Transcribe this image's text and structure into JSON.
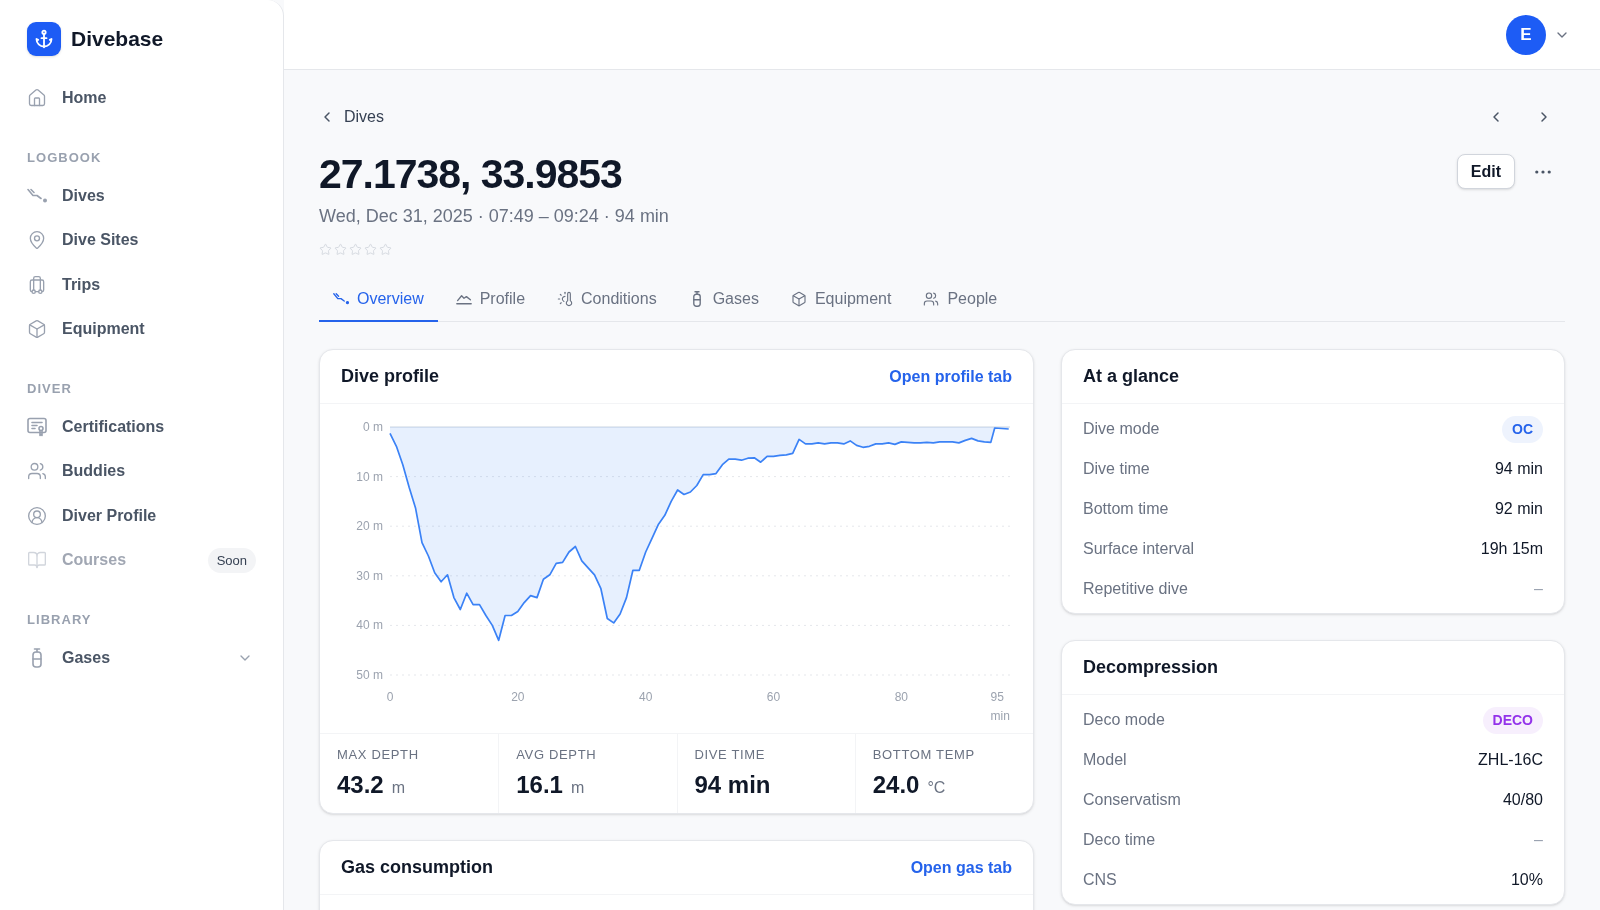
{
  "sidebar": {
    "brand": "Divebase",
    "sections": [
      {
        "items": [
          {
            "label": "Home",
            "disabled": false
          }
        ]
      },
      {
        "title": "LOGBOOK",
        "items": [
          {
            "label": "Dives",
            "disabled": false
          },
          {
            "label": "Dive Sites",
            "disabled": false
          },
          {
            "label": "Trips",
            "disabled": false
          },
          {
            "label": "Equipment",
            "disabled": false
          }
        ]
      },
      {
        "title": "DIVER",
        "items": [
          {
            "label": "Certifications",
            "disabled": false
          },
          {
            "label": "Buddies",
            "disabled": false
          },
          {
            "label": "Diver Profile",
            "disabled": false
          },
          {
            "label": "Courses",
            "disabled": true,
            "badge": "Soon"
          }
        ]
      },
      {
        "title": "LIBRARY",
        "items": [
          {
            "label": "Gases",
            "disabled": false,
            "expanded": false
          }
        ]
      }
    ]
  },
  "topbar": {
    "avatar_initial": "E"
  },
  "header": {
    "back_link": "Dives",
    "title": "27.1738, 33.9853",
    "subtitle": "Wed, Dec 31, 2025 · 07:49 – 09:24 · 94 min",
    "stars": 0,
    "edit_button": "Edit"
  },
  "tabs": [
    {
      "label": "Overview",
      "selected": true
    },
    {
      "label": "Profile",
      "selected": false
    },
    {
      "label": "Conditions",
      "selected": false
    },
    {
      "label": "Gases",
      "selected": false
    },
    {
      "label": "Equipment",
      "selected": false
    },
    {
      "label": "People",
      "selected": false
    }
  ],
  "dive_profile": {
    "title": "Dive profile",
    "link": "Open profile tab",
    "chart_data": {
      "type": "area",
      "grid": true,
      "xlabel": "min",
      "xlim": [
        0,
        97
      ],
      "ylim": [
        50,
        0
      ],
      "xticks": [
        0,
        20,
        40,
        60,
        80,
        95
      ],
      "yticks": [
        {
          "value": 0,
          "label": "0 m"
        },
        {
          "value": 10,
          "label": "10 m"
        },
        {
          "value": 20,
          "label": "20 m"
        },
        {
          "value": 30,
          "label": "30 m"
        },
        {
          "value": 40,
          "label": "40 m"
        },
        {
          "value": 50,
          "label": "50 m"
        }
      ],
      "x": [
        0,
        1,
        2,
        3,
        4,
        5,
        6,
        7,
        8,
        9,
        10,
        11,
        12,
        13,
        14,
        15,
        16,
        17,
        18,
        19,
        20,
        21,
        22,
        23,
        24,
        25,
        26,
        27,
        28,
        29,
        30,
        31,
        32,
        33,
        34,
        35,
        36,
        37,
        38,
        39,
        40,
        41,
        42,
        43,
        44,
        45,
        46,
        47,
        48,
        49,
        50,
        51,
        52,
        53,
        54,
        55,
        56,
        57,
        58,
        59,
        60,
        61,
        62,
        63,
        64,
        65,
        66,
        67,
        68,
        69,
        70,
        71,
        72,
        73,
        74,
        75,
        76,
        77,
        78,
        79,
        80,
        81,
        82,
        83,
        84,
        85,
        86,
        87,
        88,
        89,
        90,
        91,
        92,
        93,
        94,
        94.6,
        96.8
      ],
      "series": [
        {
          "color": "#3b82f6",
          "values": [
            1.3,
            3.9,
            7.6,
            12.2,
            16.4,
            23.3,
            26,
            29.4,
            31.2,
            29.8,
            34.4,
            36.8,
            33.5,
            35.8,
            35.8,
            38,
            40,
            43,
            38,
            38,
            37.2,
            35.4,
            34,
            34.4,
            30.7,
            29.8,
            27.5,
            27.3,
            25.2,
            24.1,
            27,
            28.4,
            29.8,
            32.6,
            38.6,
            39.5,
            37.7,
            34.4,
            28.9,
            28.9,
            25.2,
            22.4,
            19.6,
            17.8,
            15,
            12.7,
            13.6,
            13.1,
            11.8,
            9.6,
            9.6,
            9.4,
            7.6,
            6.5,
            6.5,
            6.7,
            6.3,
            6.2,
            7.1,
            5.9,
            5.9,
            5.7,
            5.6,
            5.3,
            2.5,
            3.4,
            3.4,
            3.2,
            3.4,
            3.2,
            3.2,
            3.4,
            2.8,
            3.7,
            4.1,
            3.9,
            3.4,
            3.4,
            3.2,
            3.5,
            3,
            3.1,
            3.2,
            3.2,
            3.1,
            3.2,
            3,
            3,
            3,
            3.2,
            2.7,
            2.3,
            2.8,
            3,
            3.1,
            0.2,
            0.4
          ]
        }
      ]
    },
    "stats": [
      {
        "label": "MAX DEPTH",
        "value": "43.2",
        "unit": "m"
      },
      {
        "label": "AVG DEPTH",
        "value": "16.1",
        "unit": "m"
      },
      {
        "label": "DIVE TIME",
        "value": "94 min"
      },
      {
        "label": "BOTTOM TEMP",
        "value": "24.0",
        "unit": "°C"
      }
    ]
  },
  "gas_consumption": {
    "title": "Gas consumption",
    "link": "Open gas tab"
  },
  "at_a_glance": {
    "title": "At a glance",
    "rows": [
      {
        "label": "Dive mode",
        "kind": "badge",
        "value": "OC",
        "color": "#2563eb"
      },
      {
        "label": "Dive time",
        "kind": "text",
        "value": "94 min"
      },
      {
        "label": "Bottom time",
        "kind": "text",
        "value": "92 min"
      },
      {
        "label": "Surface interval",
        "kind": "text",
        "value": "19h 15m"
      },
      {
        "label": "Repetitive dive",
        "kind": "empty",
        "value": "–"
      }
    ]
  },
  "decompression": {
    "title": "Decompression",
    "rows": [
      {
        "label": "Deco mode",
        "kind": "badge",
        "value": "DECO",
        "color": "#9333ea"
      },
      {
        "label": "Model",
        "kind": "text",
        "value": "ZHL-16C"
      },
      {
        "label": "Conservatism",
        "kind": "text",
        "value": "40/80"
      },
      {
        "label": "Deco time",
        "kind": "empty",
        "value": "–"
      },
      {
        "label": "CNS",
        "kind": "text",
        "value": "10%"
      }
    ]
  }
}
